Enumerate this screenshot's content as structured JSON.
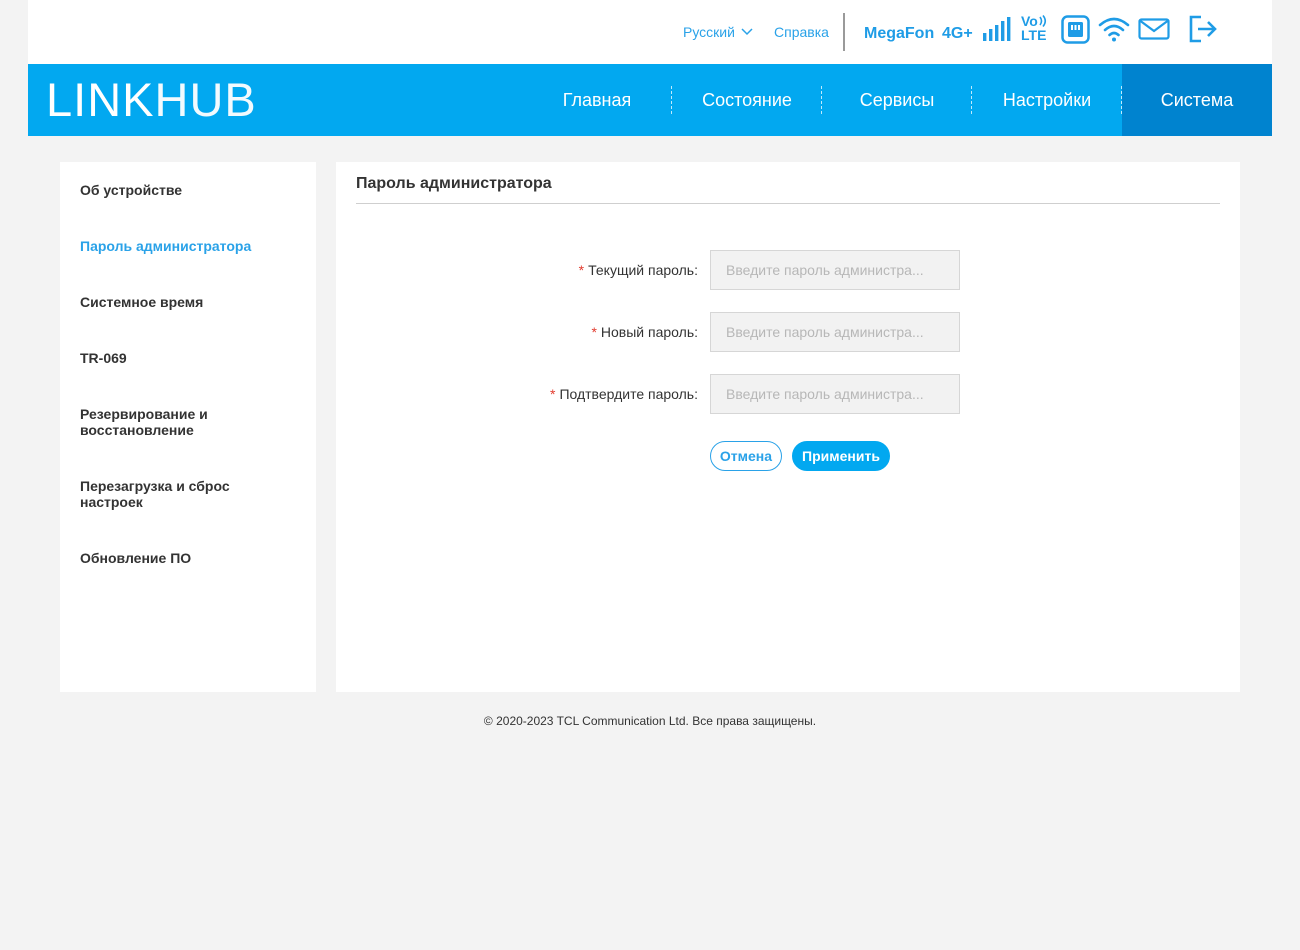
{
  "top": {
    "language": "Русский",
    "help": "Справка",
    "operator": "MegaFon",
    "network_type": "4G+",
    "volte_line1": "Vo",
    "volte_line2": "LTE",
    "icons": [
      "signal-bars-icon",
      "volte-icon",
      "sim-card-icon",
      "wifi-icon",
      "envelope-icon",
      "logout-icon"
    ],
    "signal_level": 5
  },
  "nav": {
    "logo_part1": "LINK",
    "logo_part2": "HUB",
    "items": [
      {
        "label": "Главная"
      },
      {
        "label": "Состояние"
      },
      {
        "label": "Сервисы"
      },
      {
        "label": "Настройки"
      },
      {
        "label": "Система"
      }
    ],
    "active_index": 4
  },
  "sidebar": {
    "items": [
      {
        "label": "Об устройстве"
      },
      {
        "label": "Пароль администратора"
      },
      {
        "label": "Системное время"
      },
      {
        "label": "TR-069"
      },
      {
        "label": "Резервирование и восстановление"
      },
      {
        "label": "Перезагрузка и сброс настроек"
      },
      {
        "label": "Обновление ПО"
      }
    ],
    "active_index": 1
  },
  "content": {
    "title": "Пароль администратора",
    "required_mark": "*",
    "fields": [
      {
        "label": "Текущий пароль:",
        "value": "",
        "placeholder": "Введите пароль администра..."
      },
      {
        "label": "Новый пароль:",
        "value": "",
        "placeholder": "Введите пароль администра..."
      },
      {
        "label": "Подтвердите пароль:",
        "value": "",
        "placeholder": "Введите пароль администра..."
      }
    ],
    "cancel_label": "Отмена",
    "apply_label": "Применить"
  },
  "footer": {
    "copyright": "© 2020-2023 TCL Communication Ltd. Все права защищены."
  },
  "colors": {
    "brand_blue": "#02a8f0",
    "nav_active": "#0083cf",
    "link_blue": "#2aa2e8",
    "icon_blue": "#1f9ce6",
    "required_red": "#e23b2e",
    "page_bg": "#f3f3f3"
  }
}
